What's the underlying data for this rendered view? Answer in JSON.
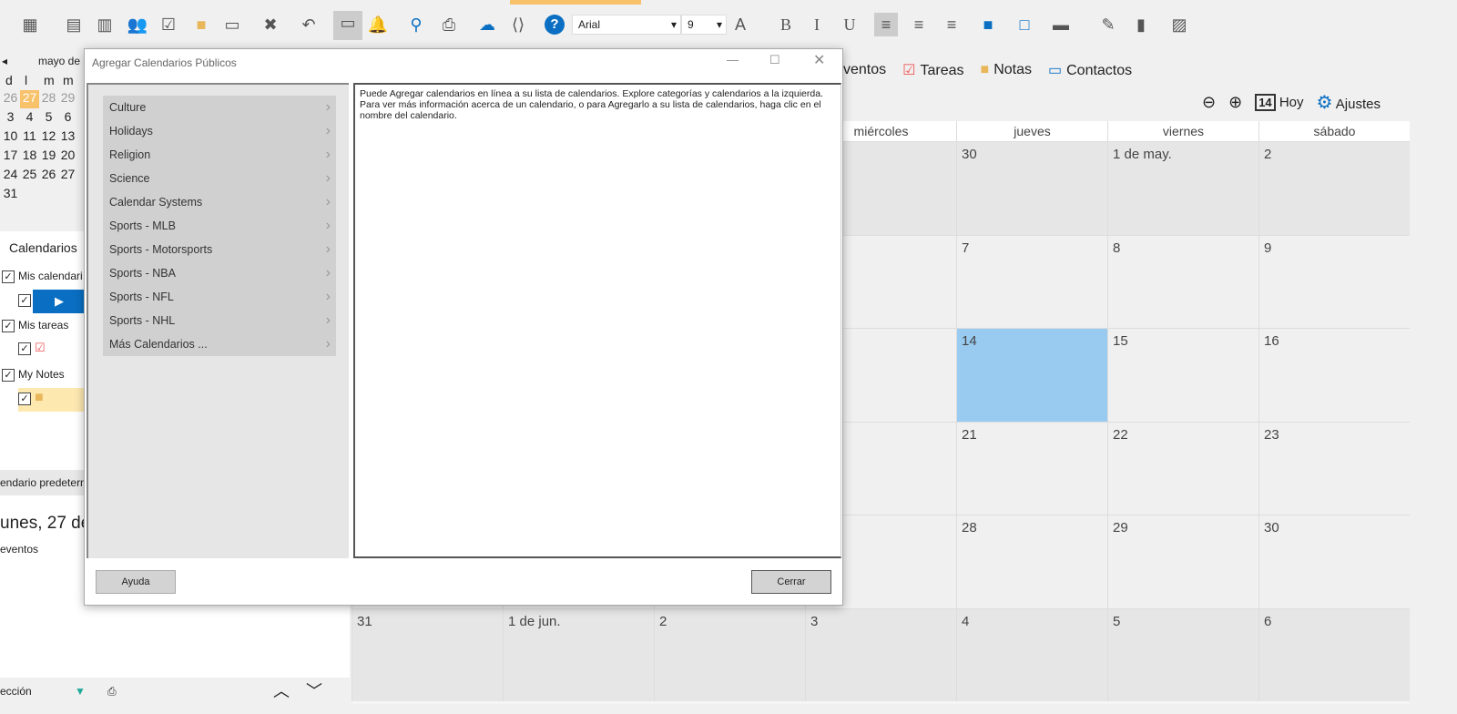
{
  "toolbar": {
    "font": "Arial",
    "size": "9",
    "icons": [
      "new-calendar",
      "calendar-view",
      "calendar-export",
      "users",
      "tasks",
      "notes",
      "contacts",
      "delete",
      "undo",
      "comment",
      "alarm",
      "search",
      "print",
      "upload",
      "html",
      "help",
      "font-color",
      "bold",
      "italic",
      "underline",
      "align-left",
      "align-center",
      "align-right",
      "fill-color",
      "border-color",
      "shade",
      "eyedropper",
      "brush",
      "image"
    ]
  },
  "colors": {
    "accent": "#f8c26a",
    "today": "#99cbf0",
    "selected": "#0a6fc2",
    "help": "#0a6fc2"
  },
  "nav": {
    "tabs": [
      "ventos",
      "Tareas",
      "Notas",
      "Contactos"
    ],
    "hoy": "Hoy",
    "ajustes": "Ajustes",
    "hoy_icon_day": "14"
  },
  "mini": {
    "title": "mayo de",
    "days": [
      "d",
      "l",
      "m",
      "m"
    ],
    "rows": [
      [
        "26",
        "27",
        "28",
        "29"
      ],
      [
        "3",
        "4",
        "5",
        "6"
      ],
      [
        "10",
        "11",
        "12",
        "13"
      ],
      [
        "17",
        "18",
        "19",
        "20"
      ],
      [
        "24",
        "25",
        "26",
        "27"
      ],
      [
        "31"
      ]
    ]
  },
  "sidebar": {
    "calendarios": "Calendarios",
    "mis_calendarios": "Mis calendari",
    "mis_tareas": "Mis tareas",
    "my_notes": "My Notes",
    "default": "endario predeterm",
    "date": "unes, 27 de",
    "events": "eventos",
    "seleccion": "ección"
  },
  "calendar": {
    "headers": [
      "",
      "",
      "",
      "miércoles",
      "jueves",
      "viernes",
      "sábado"
    ],
    "weeks": [
      [
        "",
        "",
        "",
        "",
        "30",
        "1 de may.",
        "2"
      ],
      [
        "",
        "",
        "",
        "",
        "7",
        "8",
        "9"
      ],
      [
        "",
        "",
        "",
        "",
        "14",
        "15",
        "16"
      ],
      [
        "",
        "",
        "",
        "",
        "21",
        "22",
        "23"
      ],
      [
        "",
        "",
        "",
        "",
        "28",
        "29",
        "30"
      ],
      [
        "31",
        "1 de jun.",
        "2",
        "3",
        "4",
        "5",
        "6"
      ]
    ],
    "today": "14"
  },
  "dialog": {
    "title": "Agregar Calendarios Públicos",
    "categories": [
      "Culture",
      "Holidays",
      "Religion",
      "Science",
      "Calendar Systems",
      "Sports - MLB",
      "Sports - Motorsports",
      "Sports - NBA",
      "Sports - NFL",
      "Sports - NHL",
      "Más Calendarios ..."
    ],
    "info": "Puede Agregar calendarios en línea a su lista de calendarios. Explore categorías y  calendarios a la izquierda. Para ver más información acerca de un calendario, o para Agregarlo a su lista de calendarios, haga clic en el nombre del calendario.",
    "help": "Ayuda",
    "close": "Cerrar"
  }
}
